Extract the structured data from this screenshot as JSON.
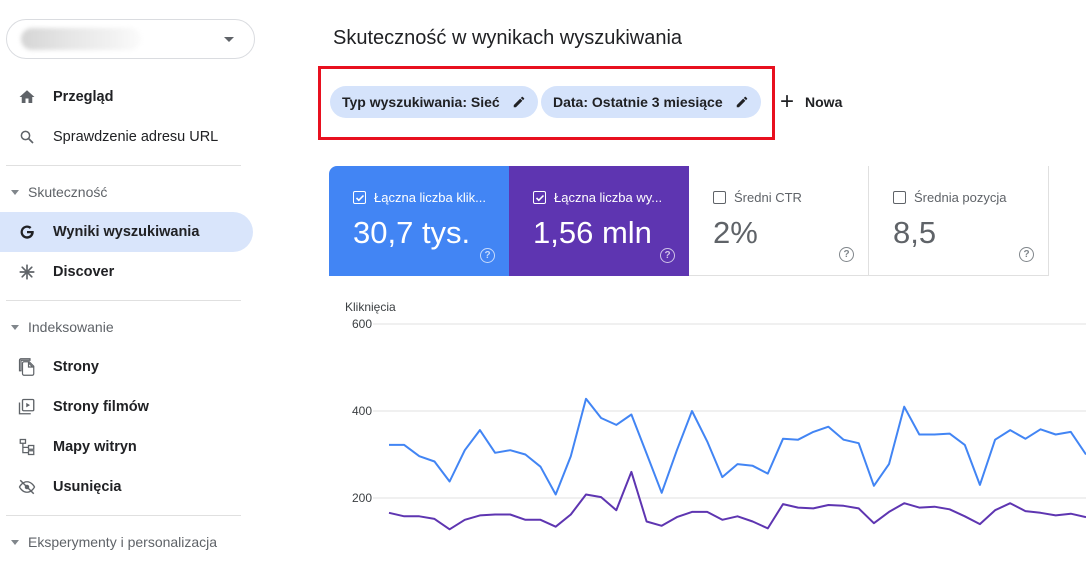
{
  "sidebar": {
    "property_selector_caret": "chevron-down-icon",
    "items": [
      {
        "label": "Przegląd",
        "icon": "home-icon"
      },
      {
        "label": "Sprawdzenie adresu URL",
        "icon": "search-icon"
      },
      {
        "label": "Wyniki wyszukiwania",
        "icon": "google-g-icon",
        "active": true
      },
      {
        "label": "Discover",
        "icon": "asterisk-icon"
      },
      {
        "label": "Strony",
        "icon": "pages-icon"
      },
      {
        "label": "Strony filmów",
        "icon": "video-pages-icon"
      },
      {
        "label": "Mapy witryn",
        "icon": "sitemap-icon"
      },
      {
        "label": "Usunięcia",
        "icon": "eye-off-icon"
      }
    ],
    "sections": [
      "Skuteczność",
      "Indeksowanie",
      "Eksperymenty i personalizacja"
    ]
  },
  "main": {
    "title": "Skuteczność w wynikach wyszukiwania",
    "filters": [
      {
        "label": "Typ wyszukiwania: Sieć"
      },
      {
        "label": "Data: Ostatnie 3 miesiące"
      }
    ],
    "new_filter_label": "Nowa",
    "metrics": [
      {
        "label": "Łączna liczba klik...",
        "value": "30,7 tys.",
        "checked": true,
        "color": "#4285f4"
      },
      {
        "label": "Łączna liczba wy...",
        "value": "1,56 mln",
        "checked": true,
        "color": "#5e35b1"
      },
      {
        "label": "Średni CTR",
        "value": "2%",
        "checked": false
      },
      {
        "label": "Średnia pozycja",
        "value": "8,5",
        "checked": false
      }
    ],
    "help_glyph": "?"
  },
  "chart_data": {
    "type": "line",
    "ylabel": "Kliknięcia",
    "yticks": [
      "600",
      "400",
      "200"
    ],
    "ylim": [
      0,
      600
    ],
    "grid": true,
    "series": [
      {
        "color": "#4285f4",
        "values": [
          322,
          322,
          296,
          284,
          238,
          310,
          356,
          304,
          310,
          300,
          272,
          208,
          296,
          428,
          384,
          368,
          392,
          302,
          212,
          310,
          400,
          330,
          248,
          278,
          274,
          256,
          336,
          334,
          352,
          364,
          334,
          326,
          228,
          278,
          410,
          346,
          346,
          348,
          322,
          230,
          334,
          356,
          336,
          358,
          346,
          352,
          300
        ]
      },
      {
        "color": "#5e35b1",
        "values": [
          166,
          158,
          158,
          152,
          128,
          150,
          160,
          162,
          162,
          150,
          150,
          134,
          162,
          208,
          202,
          172,
          260,
          146,
          136,
          156,
          168,
          168,
          150,
          158,
          146,
          130,
          186,
          178,
          176,
          184,
          182,
          176,
          142,
          168,
          188,
          178,
          180,
          174,
          158,
          140,
          172,
          188,
          170,
          166,
          160,
          164,
          156
        ]
      }
    ]
  }
}
